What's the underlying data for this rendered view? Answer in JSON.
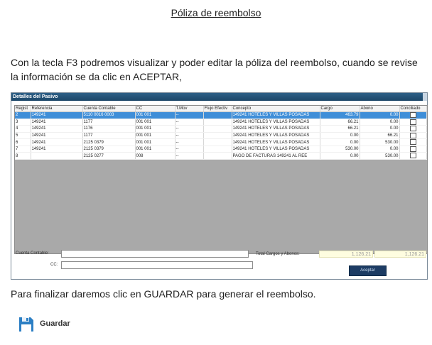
{
  "doc": {
    "title": "Póliza de reembolso",
    "paragraph1": "Con la tecla F3 podremos visualizar y poder editar la póliza del reembolso, cuando se revise la información se da clic en ACEPTAR,",
    "paragraph2": "Para finalizar daremos clic en GUARDAR para generar el reembolso."
  },
  "window": {
    "title": "Detalles del Pasivo",
    "columns": [
      "Regist",
      "Referencia",
      "Cuenta Contable",
      "CC",
      "T.Mov",
      "Flujo Efectiv",
      "Concepto",
      "Cargo",
      "Abono",
      "Conciliado"
    ],
    "rows": [
      {
        "reg": "2",
        "ref": "149241",
        "cuenta": "5110 0016 0003",
        "cc": "001 001",
        "tmov": "--",
        "flujo": "",
        "concepto": "149241 HOTELES Y VILLAS POSADAS",
        "cargo": "463.79",
        "abono": "0.00",
        "selected": true
      },
      {
        "reg": "3",
        "ref": "149241",
        "cuenta": "1177",
        "cc": "001 001",
        "tmov": "--",
        "flujo": "",
        "concepto": "149241 HOTELES Y VILLAS POSADAS",
        "cargo": "66.21",
        "abono": "0.00"
      },
      {
        "reg": "4",
        "ref": "149241",
        "cuenta": "1176",
        "cc": "001 001",
        "tmov": "--",
        "flujo": "",
        "concepto": "149241 HOTELES Y VILLAS POSADAS",
        "cargo": "66.21",
        "abono": "0.00"
      },
      {
        "reg": "5",
        "ref": "149241",
        "cuenta": "1177",
        "cc": "001 001",
        "tmov": "--",
        "flujo": "",
        "concepto": "149241 HOTELES Y VILLAS POSADAS",
        "cargo": "0.00",
        "abono": "66.21"
      },
      {
        "reg": "6",
        "ref": "149241",
        "cuenta": "2125 0379",
        "cc": "001 001",
        "tmov": "--",
        "flujo": "",
        "concepto": "149241 HOTELES Y VILLAS POSADAS",
        "cargo": "0.00",
        "abono": "530.00"
      },
      {
        "reg": "7",
        "ref": "149241",
        "cuenta": "2125 0379",
        "cc": "001 001",
        "tmov": "--",
        "flujo": "",
        "concepto": "149241 HOTELES Y VILLAS POSADAS",
        "cargo": "530.00",
        "abono": "0.00"
      },
      {
        "reg": "8",
        "ref": "",
        "cuenta": "2125 0277",
        "cc": "008",
        "tmov": "--",
        "flujo": "",
        "concepto": "PAGO DE FACTURAS 149241 AL REE",
        "cargo": "0.00",
        "abono": "530.00"
      }
    ],
    "cuenta_label": "Cuenta Contable:",
    "cc_label": "CC:",
    "totals_label": "Total Cargos y Abonos:",
    "total_cargos": "1,126.21",
    "total_abonos": "1,126.21",
    "accept_label": "Aceptar"
  },
  "toolbar": {
    "save_label": "Guardar",
    "save_icon": "floppy-disk-icon"
  }
}
